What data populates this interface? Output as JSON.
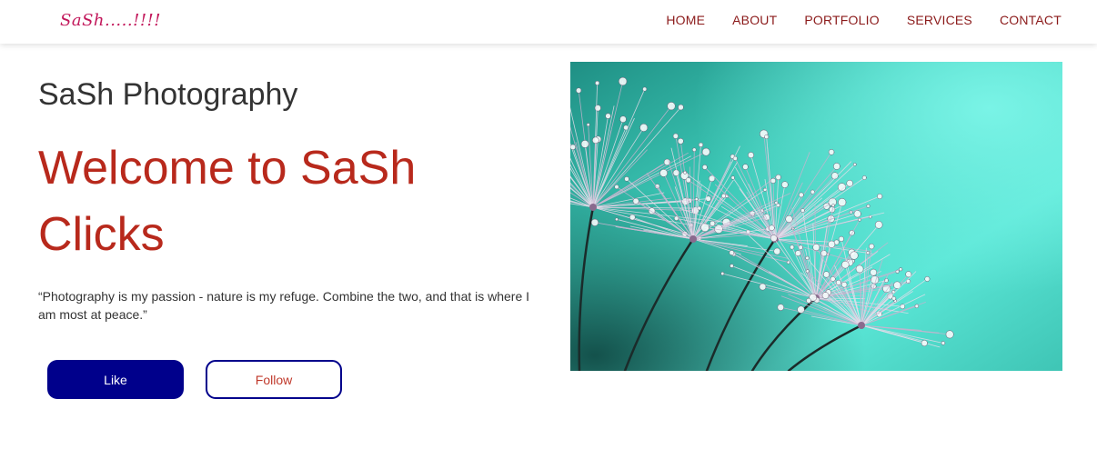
{
  "logo": "SaSh.....!!!!",
  "nav": {
    "items": [
      "HOME",
      "ABOUT",
      "PORTFOLIO",
      "SERVICES",
      "CONTACT"
    ]
  },
  "hero": {
    "site_title": "SaSh Photography",
    "heading": "Welcome to SaSh Clicks",
    "quote": "“Photography is my passion - nature is my refuge. Combine the two, and that is where I am most at peace.”",
    "like_label": "Like",
    "follow_label": "Follow"
  },
  "colors": {
    "nav_link": "#8b1a1a",
    "logo": "#c2185b",
    "heading": "#b8291c",
    "button_primary": "#00008b"
  }
}
